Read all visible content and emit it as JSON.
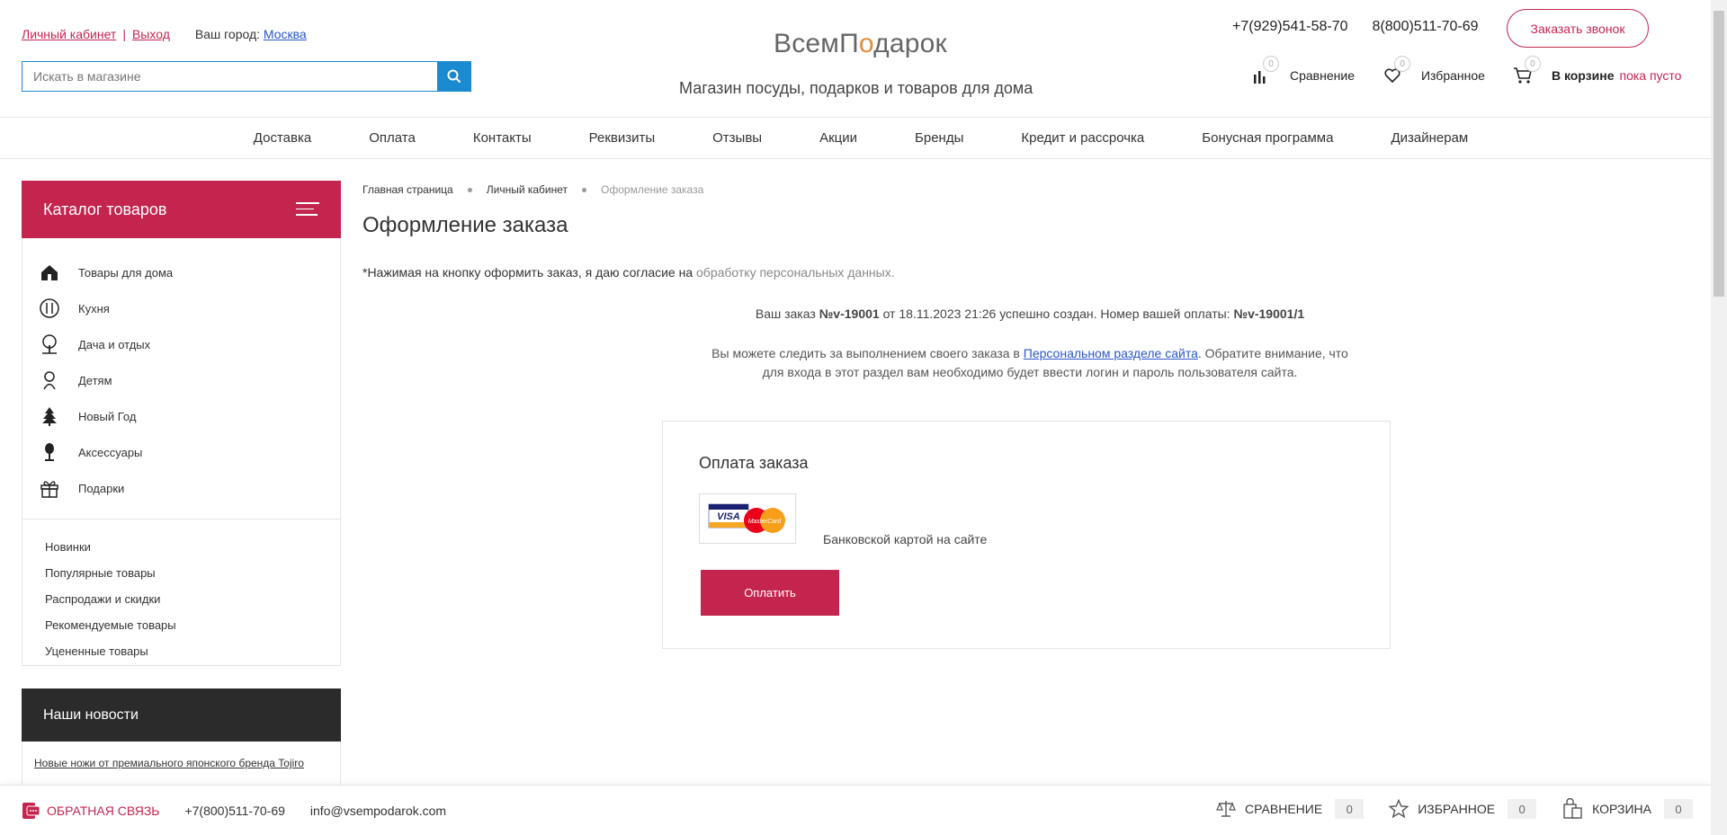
{
  "header": {
    "account_link": "Личный кабинет",
    "separator": "|",
    "logout_link": "Выход",
    "city_label": "Ваш город:",
    "city_value": "Москва",
    "search_placeholder": "Искать в магазине",
    "logo_prefix": "Всем",
    "logo_o": "П",
    "logo_mid": "о",
    "logo_suffix": "дарок",
    "tagline": "Магазин посуды, подарков и товаров для дома",
    "phone_1": "+7(929)541-58-70",
    "phone_2": "8(800)511-70-69",
    "callback_label": "Заказать звонок",
    "compare_label": "Сравнение",
    "compare_count": "0",
    "favorites_label": "Избранное",
    "favorites_count": "0",
    "cart_label": "В корзине",
    "cart_count": "0",
    "cart_status": "пока пусто"
  },
  "nav": [
    "Доставка",
    "Оплата",
    "Контакты",
    "Реквизиты",
    "Отзывы",
    "Акции",
    "Бренды",
    "Кредит и рассрочка",
    "Бонусная программа",
    "Дизайнерам"
  ],
  "sidebar": {
    "catalog_title": "Каталог товаров",
    "categories": [
      {
        "label": "Товары для дома",
        "icon": "house-icon"
      },
      {
        "label": "Кухня",
        "icon": "kitchen-icon"
      },
      {
        "label": "Дача и отдых",
        "icon": "tree-icon"
      },
      {
        "label": "Детям",
        "icon": "child-icon"
      },
      {
        "label": "Новый Год",
        "icon": "christmas-tree-icon"
      },
      {
        "label": "Аксессуары",
        "icon": "accessory-icon"
      },
      {
        "label": "Подарки",
        "icon": "gift-icon"
      }
    ],
    "subs": [
      "Новинки",
      "Популярные товары",
      "Распродажи и скидки",
      "Рекомендуемые товары",
      "Уцененные товары"
    ],
    "news_title": "Наши новости",
    "news_link": "Новые ножи от премиального японского бренда Tojiro"
  },
  "main": {
    "breadcrumbs": [
      "Главная страница",
      "Личный кабинет",
      "Оформление заказа"
    ],
    "title": "Оформление заказа",
    "consent_text": "*Нажимая на кнопку оформить заказ, я даю согласие на ",
    "consent_link": "обработку персональных данных.",
    "order_prefix": "Ваш заказ ",
    "order_number": "№v-19001",
    "order_middle": " от 18.11.2023 21:26 успешно создан. Номер вашей оплаты: ",
    "payment_number": "№v-19001/1",
    "track_prefix": "Вы можете следить за выполнением своего заказа в ",
    "track_link": "Персональном разделе сайта",
    "track_suffix": ". Обратите внимание, что для входа в этот раздел вам необходимо будет ввести логин и пароль пользователя сайта.",
    "payment_title": "Оплата заказа",
    "card_visa": "VISA",
    "card_mc": "MasterCard",
    "payment_method": "Банковской картой на сайте",
    "pay_button": "Оплатить"
  },
  "footer": {
    "feedback": "ОБРАТНАЯ СВЯЗЬ",
    "phone": "+7(800)511-70-69",
    "email": "info@vsempodarok.com",
    "compare": "Сравнение",
    "compare_count": "0",
    "favorites": "Избранное",
    "favorites_count": "0",
    "cart": "Корзина",
    "cart_count": "0"
  },
  "colors": {
    "accent": "#c4254f",
    "search_blue": "#1a8bd0",
    "dark": "#2b2b2b",
    "link_blue": "#2b56c9"
  }
}
